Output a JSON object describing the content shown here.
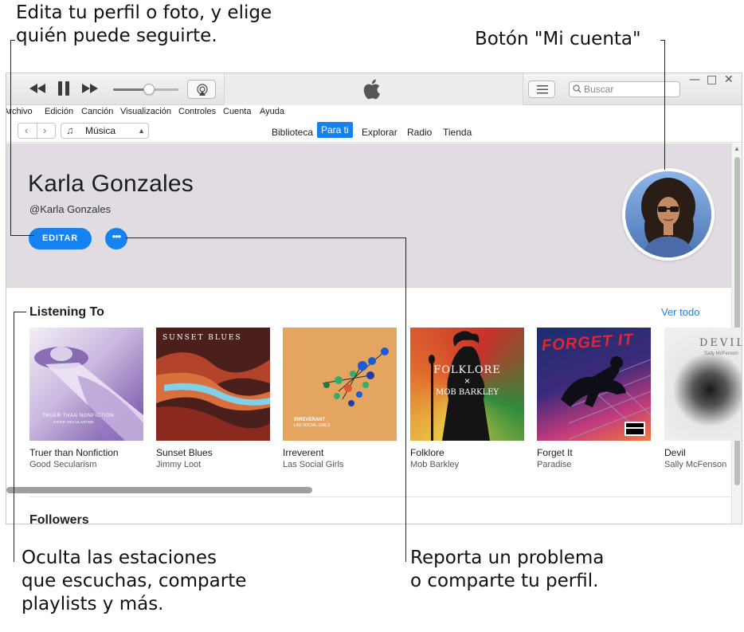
{
  "callouts": {
    "top_left_line1": "Edita tu perfil o foto, y elige",
    "top_left_line2": "quién puede seguirte.",
    "top_right": "Botón \"Mi cuenta\"",
    "bottom_left_line1": "Oculta las estaciones",
    "bottom_left_line2": "que escuchas, comparte",
    "bottom_left_line3": "playlists y más.",
    "bottom_right_line1": "Reporta un problema",
    "bottom_right_line2": "o comparte tu perfil."
  },
  "toolbar": {
    "prev_icon": "rewind-icon",
    "play_icon": "pause-icon",
    "next_icon": "fast-forward-icon",
    "volume_level": 0.55,
    "airplay_icon": "airplay-icon",
    "logo_icon": "apple-logo-icon",
    "list_icon": "list-icon",
    "search_placeholder": "Buscar",
    "window_controls": [
      "—",
      "□",
      "✕"
    ]
  },
  "menu": [
    "Archivo",
    "Edición",
    "Canción",
    "Visualización",
    "Controles",
    "Cuenta",
    "Ayuda"
  ],
  "nav": {
    "back": "‹",
    "forward": "›",
    "source": "Música",
    "tabs": [
      "Biblioteca",
      "Para ti",
      "Explorar",
      "Radio",
      "Tienda"
    ],
    "active_tab": "Para ti"
  },
  "profile": {
    "name": "Karla Gonzales",
    "handle": "@Karla Gonzales",
    "edit_label": "EDITAR",
    "more_label": "•••"
  },
  "listening": {
    "title": "Listening To",
    "see_all": "Ver todo",
    "albums": [
      {
        "title": "Truer than Nonfiction",
        "artist": "Good Secularism",
        "art_text": "TRUER THAN NONFICTION",
        "art_sub": "GOOD SECULARISM"
      },
      {
        "title": "Sunset Blues",
        "artist": "Jimmy Loot",
        "art_text": "SUNSET BLUES"
      },
      {
        "title": "Irreverent",
        "artist": "Las Social Girls",
        "art_text": "IRREVERANT",
        "art_sub": "LAS SOCIAL GIRLS"
      },
      {
        "title": "Folklore",
        "artist": "Mob Barkley",
        "art_text": "FOLKLORE",
        "art_x": "×",
        "art_sub": "MOB BARKLEY"
      },
      {
        "title": "Forget It",
        "artist": "Paradise",
        "art_text": "FORGET IT",
        "art_badge": "PARENTAL ADVISORY"
      },
      {
        "title": "Devil",
        "artist": "Sally McFenson",
        "art_text": "DEVIL",
        "art_sub": "Sally McFenson"
      }
    ]
  },
  "followers": {
    "title": "Followers"
  }
}
